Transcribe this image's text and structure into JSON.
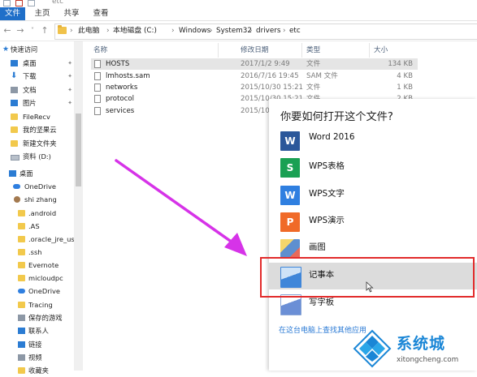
{
  "window": {
    "title": "etc"
  },
  "ribbon": {
    "tabs": [
      "文件",
      "主页",
      "共享",
      "查看"
    ]
  },
  "breadcrumb": [
    "此电脑",
    "本地磁盘 (C:)",
    "Windows",
    "System32",
    "drivers",
    "etc"
  ],
  "nav": [
    {
      "label": "快速访问",
      "icon": "star-icon",
      "pinned": false
    },
    {
      "label": "桌面",
      "icon": "desktop-icon",
      "pinned": true
    },
    {
      "label": "下载",
      "icon": "download-icon",
      "pinned": true
    },
    {
      "label": "文档",
      "icon": "document-icon",
      "pinned": true
    },
    {
      "label": "图片",
      "icon": "picture-icon",
      "pinned": true
    },
    {
      "label": "FileRecv",
      "icon": "folder-icon",
      "pinned": false
    },
    {
      "label": "我的坚果云",
      "icon": "folder-icon",
      "pinned": false
    },
    {
      "label": "新建文件夹",
      "icon": "folder-icon",
      "pinned": false
    },
    {
      "label": "资料 (D:)",
      "icon": "drive-icon",
      "pinned": false
    },
    {
      "label": "桌面",
      "icon": "desktop-icon",
      "pinned": false
    },
    {
      "label": "OneDrive",
      "icon": "cloud-icon",
      "pinned": false
    },
    {
      "label": "shi zhang",
      "icon": "user-icon",
      "pinned": false
    },
    {
      "label": ".android",
      "icon": "folder-icon",
      "pinned": false
    },
    {
      "label": ".AS",
      "icon": "folder-icon",
      "pinned": false
    },
    {
      "label": ".oracle_jre_us",
      "icon": "folder-icon",
      "pinned": false
    },
    {
      "label": ".ssh",
      "icon": "folder-icon",
      "pinned": false
    },
    {
      "label": "Evernote",
      "icon": "folder-icon",
      "pinned": false
    },
    {
      "label": "micloudpc",
      "icon": "folder-icon",
      "pinned": false
    },
    {
      "label": "OneDrive",
      "icon": "cloud-icon",
      "pinned": false
    },
    {
      "label": "Tracing",
      "icon": "folder-icon",
      "pinned": false
    },
    {
      "label": "保存的游戏",
      "icon": "game-icon",
      "pinned": false
    },
    {
      "label": "联系人",
      "icon": "contacts-icon",
      "pinned": false
    },
    {
      "label": "链接",
      "icon": "link-icon",
      "pinned": false
    },
    {
      "label": "视频",
      "icon": "video-icon",
      "pinned": false
    },
    {
      "label": "收藏夹",
      "icon": "favorites-icon",
      "pinned": false
    }
  ],
  "columns": {
    "name": "名称",
    "date": "修改日期",
    "type": "类型",
    "size": "大小"
  },
  "files": [
    {
      "name": "HOSTS",
      "date": "2017/1/2 9:49",
      "type": "文件",
      "size": "134 KB"
    },
    {
      "name": "lmhosts.sam",
      "date": "2016/7/16 19:45",
      "type": "SAM 文件",
      "size": "4 KB"
    },
    {
      "name": "networks",
      "date": "2015/10/30 15:21",
      "type": "文件",
      "size": "1 KB"
    },
    {
      "name": "protocol",
      "date": "2015/10/30 15:21",
      "type": "文件",
      "size": "2 KB"
    },
    {
      "name": "services",
      "date": "2015/10",
      "type": "",
      "size": ""
    }
  ],
  "dialog": {
    "title": "你要如何打开这个文件?",
    "apps": [
      {
        "name": "Word 2016",
        "icon": "word-icon",
        "color": "#2b579a",
        "glyph": "W"
      },
      {
        "name": "WPS表格",
        "icon": "wps-spreadsheet-icon",
        "color": "#1aa053",
        "glyph": "S"
      },
      {
        "name": "WPS文字",
        "icon": "wps-writer-icon",
        "color": "#2f7fe0",
        "glyph": "W"
      },
      {
        "name": "WPS演示",
        "icon": "wps-presentation-icon",
        "color": "#f06a28",
        "glyph": "P"
      },
      {
        "name": "画图",
        "icon": "paint-icon",
        "color": "#5e8fcf",
        "glyph": ""
      },
      {
        "name": "记事本",
        "icon": "notepad-icon",
        "color": "#3f86d9",
        "glyph": ""
      },
      {
        "name": "写字板",
        "icon": "wordpad-icon",
        "color": "#6b8fd6",
        "glyph": ""
      }
    ],
    "more_link": "在这台电脑上查找其他应用"
  },
  "watermark": {
    "title": "系统城",
    "url": "xitongcheng.com"
  },
  "colors": {
    "accent": "#1f6fc9",
    "highlight_box": "#e22b2b",
    "arrow": "#d633e8",
    "link": "#2a7ad5"
  }
}
